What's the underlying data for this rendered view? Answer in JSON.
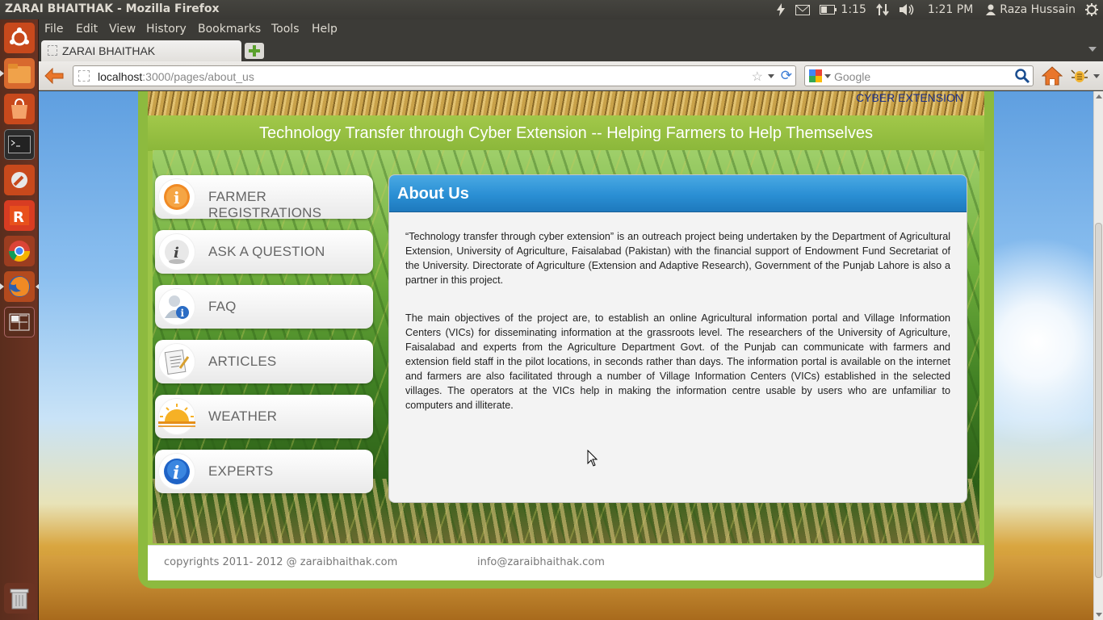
{
  "window": {
    "title": "ZARAI BHAITHAK - Mozilla Firefox"
  },
  "tray": {
    "battery": "1:15",
    "clock": "1:21 PM",
    "user": "Raza Hussain"
  },
  "menubar": {
    "items": [
      "File",
      "Edit",
      "View",
      "History",
      "Bookmarks",
      "Tools",
      "Help"
    ]
  },
  "tabs": [
    {
      "label": "ZARAI BHAITHAK"
    }
  ],
  "urlbar": {
    "host": "localhost",
    "path": ":3000/pages/about_us"
  },
  "search": {
    "placeholder": "Google"
  },
  "site": {
    "banner_text": "CYBER EXTENSION",
    "tagline": "Technology Transfer through Cyber Extension -- Helping Farmers to Help Themselves",
    "menu": [
      {
        "label": "FARMER REGISTRATIONS",
        "icon": "info-orange-icon"
      },
      {
        "label": "ASK A QUESTION",
        "icon": "info-gray-icon"
      },
      {
        "label": "FAQ",
        "icon": "user-info-icon"
      },
      {
        "label": "ARTICLES",
        "icon": "document-icon"
      },
      {
        "label": "WEATHER",
        "icon": "sun-icon"
      },
      {
        "label": "EXPERTS",
        "icon": "info-blue-icon"
      }
    ],
    "about": {
      "title": "About Us",
      "paragraphs": [
        "“Technology transfer through cyber extension” is an outreach project being undertaken by the Department of Agricultural Extension, University of Agriculture, Faisalabad (Pakistan) with the financial support of Endowment Fund Secretariat of the University. Directorate of Agriculture (Extension and Adaptive Research), Government of the Punjab Lahore is also a partner in this project.",
        "The main objectives of the project are, to establish an online Agricultural information portal and Village Information Centers (VICs) for disseminating information at the grassroots level. The researchers of the University of Agriculture, Faisalabad and experts from the Agriculture Department Govt. of the Punjab can communicate with farmers and extension field staff in the pilot locations, in seconds rather than days. The information portal is available on the internet and farmers are also facilitated through a number of Village Information Centers (VICs) established in the selected villages. The operators at the VICs help in making the information centre usable by users who are unfamiliar to computers and illiterate."
      ]
    },
    "footer": {
      "copyright": "copyrights 2011- 2012 @ zaraibhaithak.com",
      "email": "info@zaraibhaithak.com"
    }
  },
  "colors": {
    "site_green": "#8dba3f",
    "header_blue": "#2a8fd4",
    "launcher_brown": "#6b3322"
  }
}
